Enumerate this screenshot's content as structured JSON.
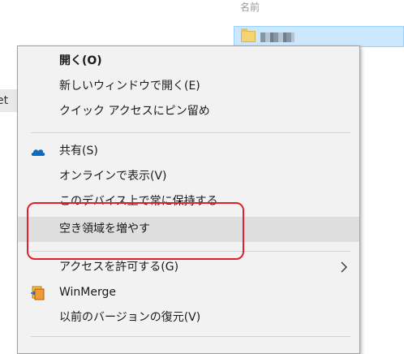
{
  "explorer": {
    "column_header": "名前",
    "left_tab_text": "et"
  },
  "menu": {
    "items": [
      {
        "label": "開く(O)"
      },
      {
        "label": "新しいウィンドウで開く(E)"
      },
      {
        "label": "クイック アクセスにピン留め"
      },
      {
        "label": "共有(S)",
        "icon": "onedrive-cloud-icon"
      },
      {
        "label": "オンラインで表示(V)"
      },
      {
        "label": "このデバイス上で常に保持する"
      },
      {
        "label": "空き領域を増やす"
      },
      {
        "label": "アクセスを許可する(G)"
      },
      {
        "label": "WinMerge",
        "icon": "winmerge-icon"
      },
      {
        "label": "以前のバージョンの復元(V)"
      }
    ]
  },
  "colors": {
    "menu_bg": "#f2f2f2",
    "hover_bg": "#dedede",
    "selection_bg": "#cce8ff",
    "annotation_red": "#e0202a",
    "onedrive_blue": "#0f6cbd"
  }
}
